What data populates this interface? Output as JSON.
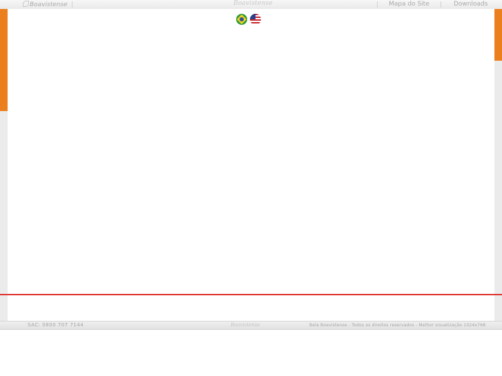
{
  "topbar": {
    "brand_left": "Boavistense",
    "center_logo": "Boavistense",
    "links": [
      "Mapa do Site",
      "Downloads"
    ]
  },
  "languages": [
    {
      "name": "Português",
      "icon": "brazil-flag-icon"
    },
    {
      "name": "English",
      "icon": "usa-flag-icon"
    }
  ],
  "footer": {
    "sac": "SAC: 0800 707 7144",
    "logo": "Boavistense",
    "rights": "Bela Boavistense - Todos os direitos reservados - Melhor visualização 1024x768"
  },
  "colors": {
    "accent": "#ec7f1d",
    "divider": "#e0302a"
  }
}
